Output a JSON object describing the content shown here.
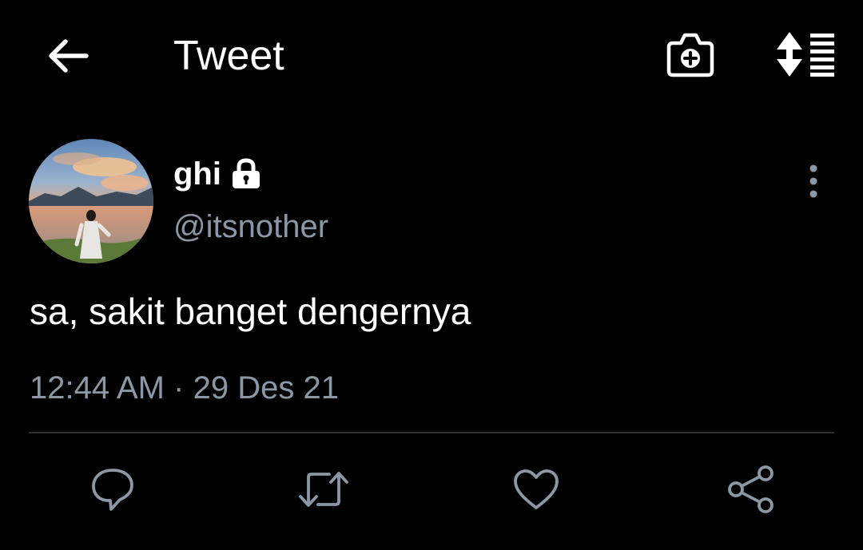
{
  "header": {
    "title": "Tweet",
    "back_icon": "arrow-left-icon",
    "camera_icon": "camera-plus-icon",
    "sort_icon": "sort-list-icon"
  },
  "author": {
    "display_name": "ghi",
    "handle": "@itsnother",
    "protected_icon": "lock-icon",
    "avatar": "avatar-photo"
  },
  "tweet": {
    "text": "sa, sakit banget dengernya",
    "time": "12:44 AM",
    "separator": "·",
    "date": "29 Des 21"
  },
  "actions": {
    "reply_icon": "reply-icon",
    "retweet_icon": "retweet-icon",
    "like_icon": "heart-icon",
    "share_icon": "share-icon"
  },
  "colors": {
    "background": "#000000",
    "primary_text": "#ffffff",
    "secondary_text": "#8b98a5",
    "divider": "#2f3336"
  }
}
